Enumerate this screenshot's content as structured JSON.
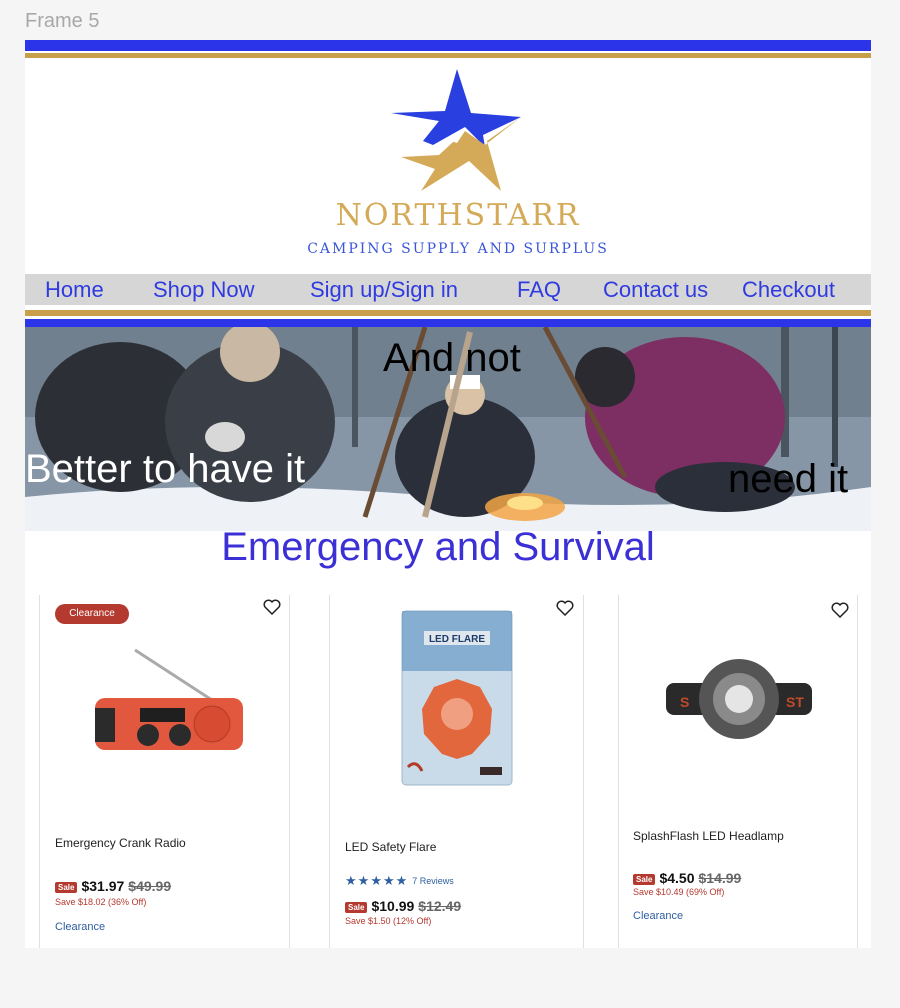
{
  "frame_label": "Frame 5",
  "brand": {
    "name": "NORTHSTARR",
    "tagline": "CAMPING SUPPLY AND SURPLUS"
  },
  "nav": {
    "items": [
      {
        "label": "Home"
      },
      {
        "label": "Shop Now"
      },
      {
        "label": "Sign up/Sign in"
      },
      {
        "label": "FAQ"
      },
      {
        "label": "Contact us"
      },
      {
        "label": "Checkout"
      }
    ]
  },
  "hero": {
    "line_top": "And not",
    "line_left": "Better to have it",
    "line_right": "need it"
  },
  "section": {
    "title": "Emergency and Survival"
  },
  "products": [
    {
      "badge": "Clearance",
      "name": "Emergency Crank Radio",
      "sale_tag": "Sale",
      "price": "$31.97",
      "was": "$49.99",
      "save": "Save $18.02 (36% Off)",
      "link": "Clearance",
      "icon": "crank-radio"
    },
    {
      "name": "LED Safety Flare",
      "rating": 5,
      "reviews": "7 Reviews",
      "sale_tag": "Sale",
      "price": "$10.99",
      "was": "$12.49",
      "save": "Save $1.50 (12% Off)",
      "package_text": "LED FLARE",
      "icon": "led-flare"
    },
    {
      "name": "SplashFlash LED Headlamp",
      "sale_tag": "Sale",
      "price": "$4.50",
      "was": "$14.99",
      "save": "Save $10.49 (69% Off)",
      "link": "Clearance",
      "icon": "headlamp"
    }
  ],
  "colors": {
    "brand_blue": "#2b34e8",
    "brand_gold": "#c8a04b",
    "nav_text": "#2f3be0",
    "sale_red": "#b4392f",
    "link_blue": "#2f5fa0"
  }
}
